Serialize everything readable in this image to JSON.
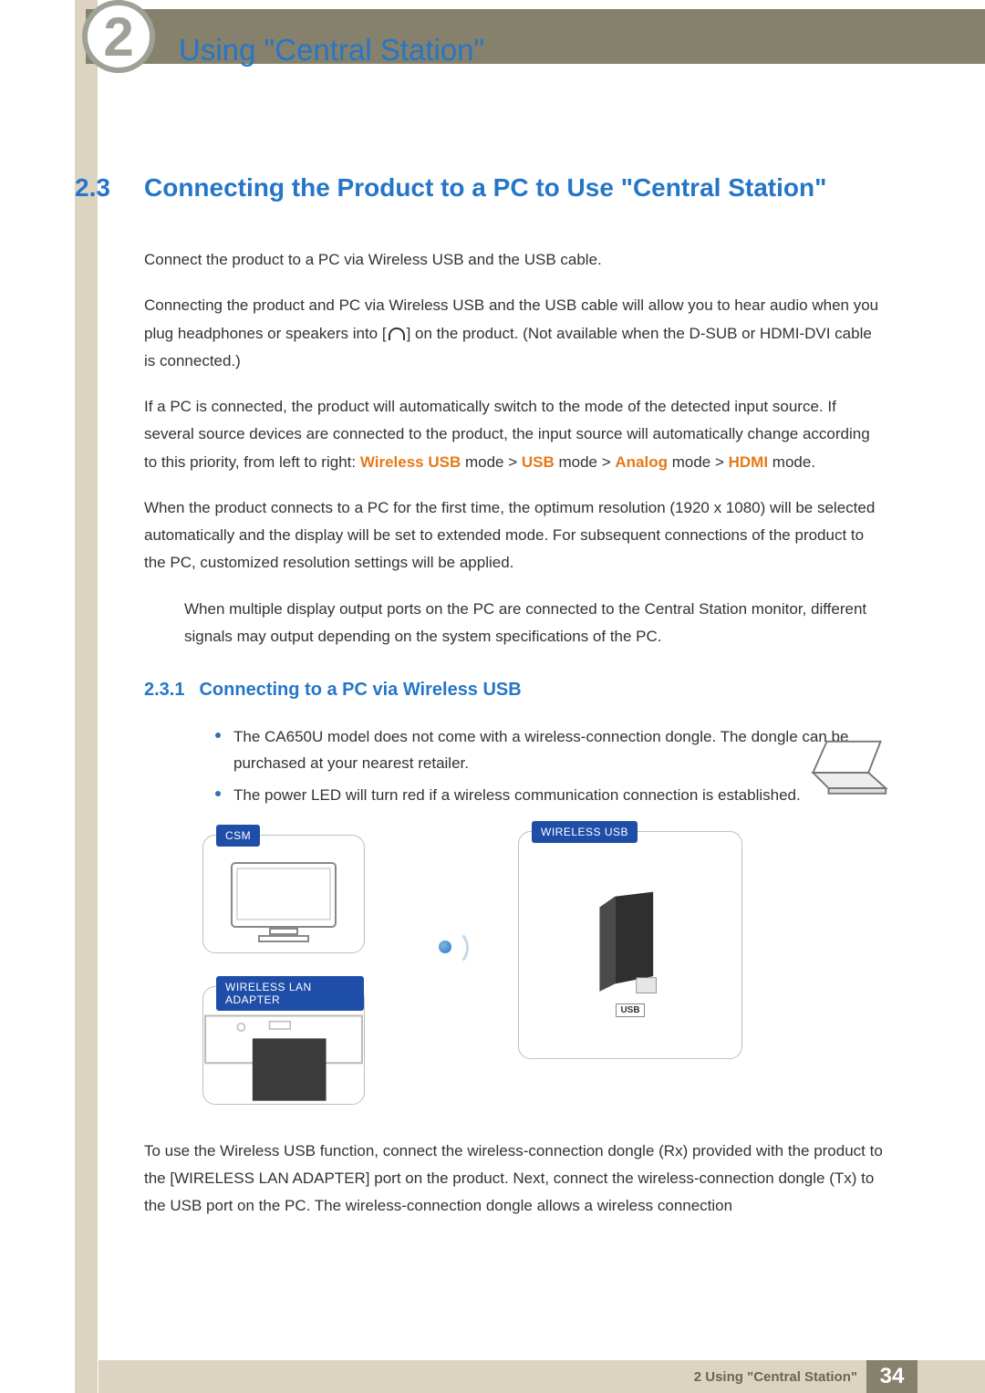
{
  "chapter": {
    "title": "Using \"Central Station\"",
    "number_glyph": "2"
  },
  "section": {
    "number": "2.3",
    "title": "Connecting the Product to a PC to Use \"Central Station\""
  },
  "paragraphs": {
    "p1": "Connect the product to a PC via Wireless USB and the USB cable.",
    "p2a": "Connecting the product and PC via Wireless USB and the USB cable will allow you to hear audio when you plug headphones or speakers into [",
    "p2b": "] on the product. (Not available when the D-SUB or HDMI-DVI cable is connected.)",
    "p3a": "If a PC is connected, the product will automatically switch to the mode of the detected input source. If several source devices are connected to the product, the input source will automatically change according to this priority, from left to right: ",
    "p3_wireless": "Wireless USB",
    "p3_mode1": " mode > ",
    "p3_usb": "USB",
    "p3_mode2": " mode > ",
    "p3_analog": "Analog",
    "p3_mode3": " mode > ",
    "p3_hdmi": "HDMI",
    "p3_mode4": " mode.",
    "p4": "When the product connects to a PC for the first time, the optimum resolution (1920 x 1080) will be selected automatically and the display will be set to extended mode. For subsequent connections of the product to the PC, customized resolution settings will be applied.",
    "note": "When multiple display output ports on the PC are connected to the Central Station monitor, different signals may output depending on the system specifications of the PC."
  },
  "subsection": {
    "number": "2.3.1",
    "title": "Connecting to a PC via Wireless USB"
  },
  "bullets": [
    "The CA650U model does not come with a wireless-connection dongle. The dongle can be purchased at your nearest retailer.",
    "The power LED will turn red if a wireless communication connection is established."
  ],
  "diagram": {
    "tag_csm": "CSM",
    "tag_wlan": "WIRELESS LAN ADAPTER",
    "tag_wusb": "WIRELESS USB",
    "usb_label": "USB"
  },
  "after_diagram": "To use the Wireless USB function, connect the wireless-connection dongle (Rx) provided with the product to the [WIRELESS LAN ADAPTER] port on the product. Next, connect the wireless-connection dongle (Tx) to the USB port on the PC. The wireless-connection dongle allows a wireless connection",
  "footer": {
    "text": "2 Using \"Central Station\"",
    "page": "34"
  }
}
